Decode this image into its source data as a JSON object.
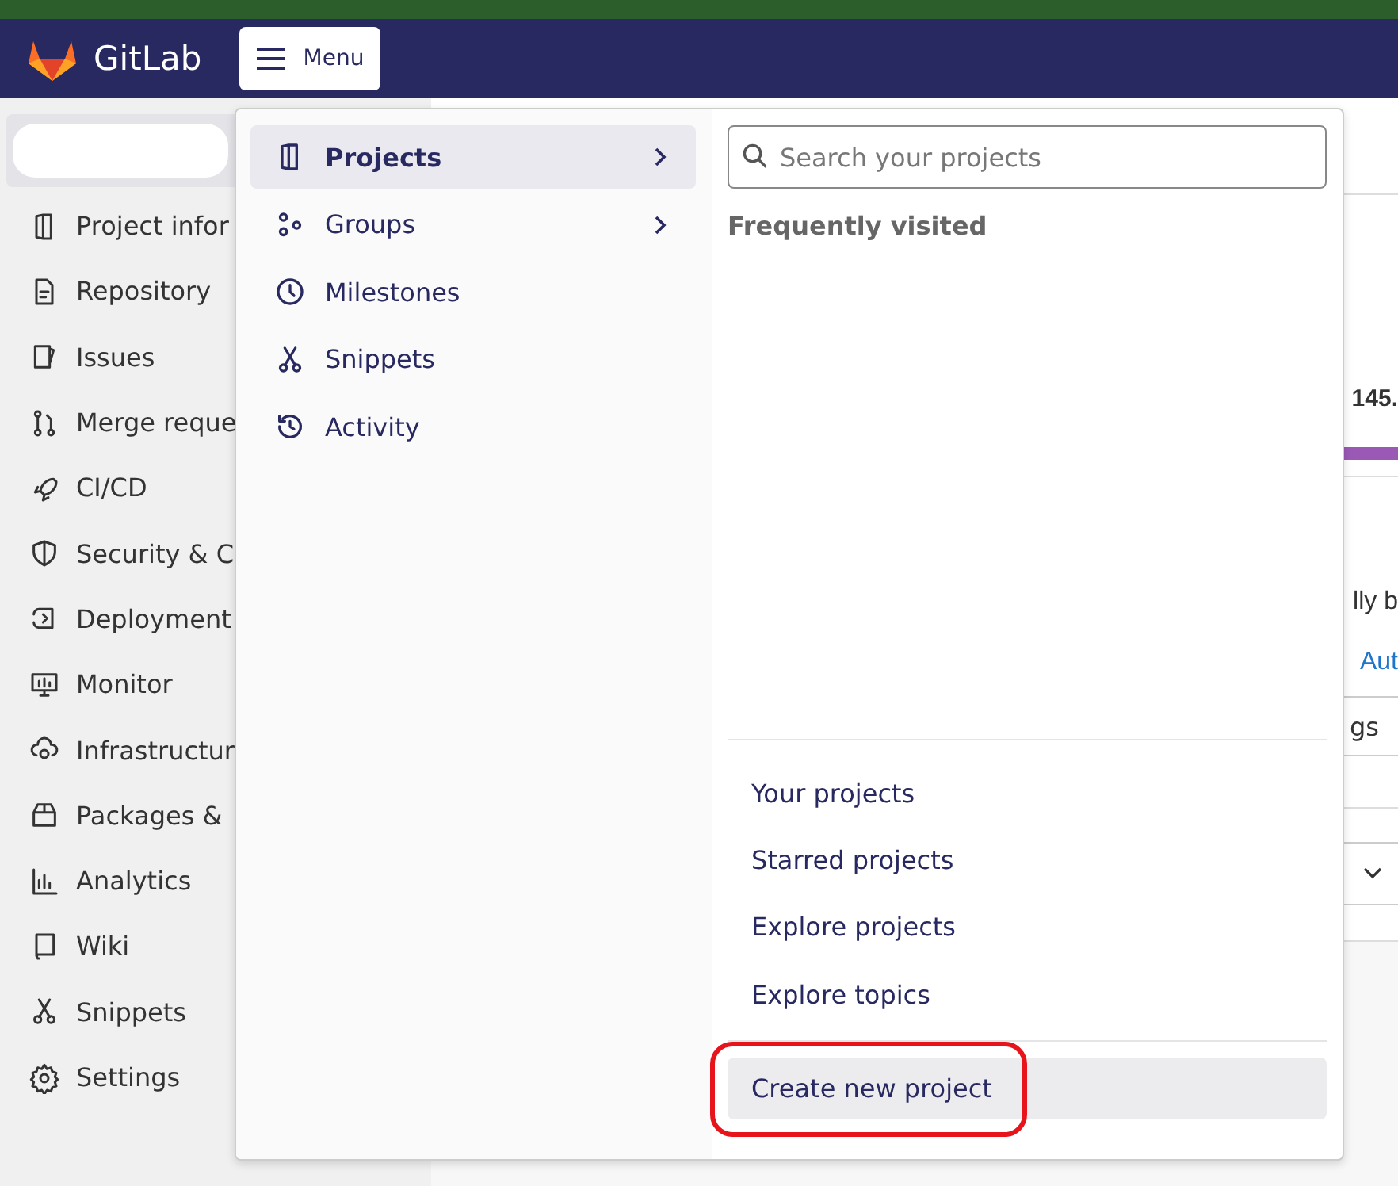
{
  "header": {
    "logo": "GitLab",
    "menu_button": "Menu"
  },
  "sidebar": {
    "items": [
      {
        "label": "Project infor"
      },
      {
        "label": "Repository"
      },
      {
        "label": "Issues"
      },
      {
        "label": "Merge reque"
      },
      {
        "label": "CI/CD"
      },
      {
        "label": "Security & C"
      },
      {
        "label": "Deployment"
      },
      {
        "label": "Monitor"
      },
      {
        "label": "Infrastructur"
      },
      {
        "label": "Packages &"
      },
      {
        "label": "Analytics"
      },
      {
        "label": "Wiki"
      },
      {
        "label": "Snippets"
      },
      {
        "label": "Settings"
      }
    ]
  },
  "menu": {
    "categories": [
      {
        "label": "Projects",
        "selected": true,
        "submenu": true
      },
      {
        "label": "Groups",
        "selected": false,
        "submenu": true
      },
      {
        "label": "Milestones",
        "selected": false,
        "submenu": false
      },
      {
        "label": "Snippets",
        "selected": false,
        "submenu": false
      },
      {
        "label": "Activity",
        "selected": false,
        "submenu": false
      }
    ],
    "search": {
      "placeholder": "Search your projects"
    },
    "section_title": "Frequently visited",
    "links": [
      "Your projects",
      "Starred projects",
      "Explore projects",
      "Explore topics"
    ],
    "create": {
      "label": "Create new project",
      "highlighted": true
    }
  },
  "background": {
    "heading": "145.",
    "text": "lly b",
    "link": "Aut",
    "button": "gs"
  }
}
